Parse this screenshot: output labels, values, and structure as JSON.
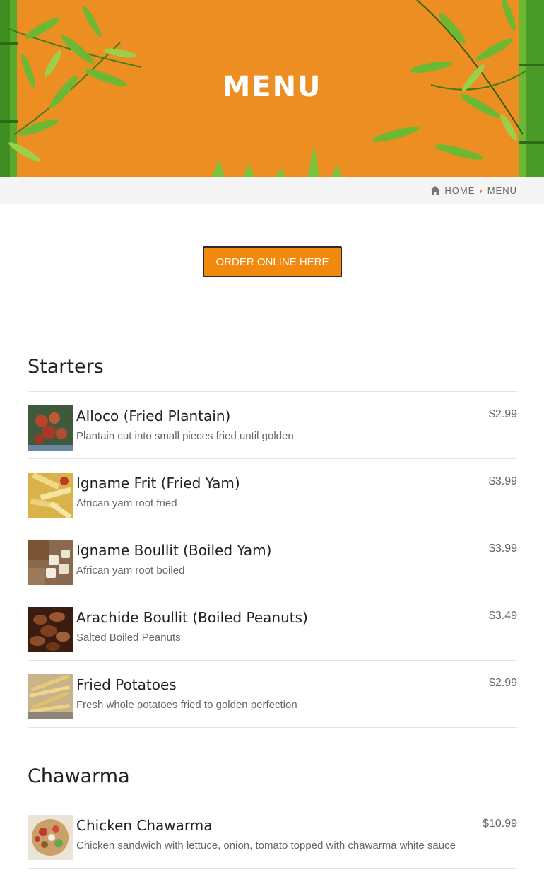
{
  "hero": {
    "title": "MENU"
  },
  "breadcrumb": {
    "home": "HOME",
    "current": "MENU"
  },
  "order_button": "ORDER ONLINE HERE",
  "sections": [
    {
      "title": "Starters",
      "items": [
        {
          "name": "Alloco (Fried Plantain)",
          "desc": "Plantain cut into small pieces fried until golden",
          "price": "$2.99"
        },
        {
          "name": "Igname Frit (Fried Yam)",
          "desc": "African yam root fried",
          "price": "$3.99"
        },
        {
          "name": "Igname Boullit (Boiled Yam)",
          "desc": "African yam root boiled",
          "price": "$3.99"
        },
        {
          "name": "Arachide Boullit (Boiled Peanuts)",
          "desc": "Salted Boiled Peanuts",
          "price": "$3.49"
        },
        {
          "name": "Fried Potatoes",
          "desc": "Fresh whole potatoes fried to golden perfection",
          "price": "$2.99"
        }
      ]
    },
    {
      "title": "Chawarma",
      "items": [
        {
          "name": "Chicken Chawarma",
          "desc": "Chicken sandwich with lettuce, onion, tomato topped with chawarma white sauce",
          "price": "$10.99"
        }
      ]
    }
  ],
  "colors": {
    "accent": "#ec8e22",
    "button": "#f2890f",
    "breadcrumb_sep": "#e8611a"
  }
}
